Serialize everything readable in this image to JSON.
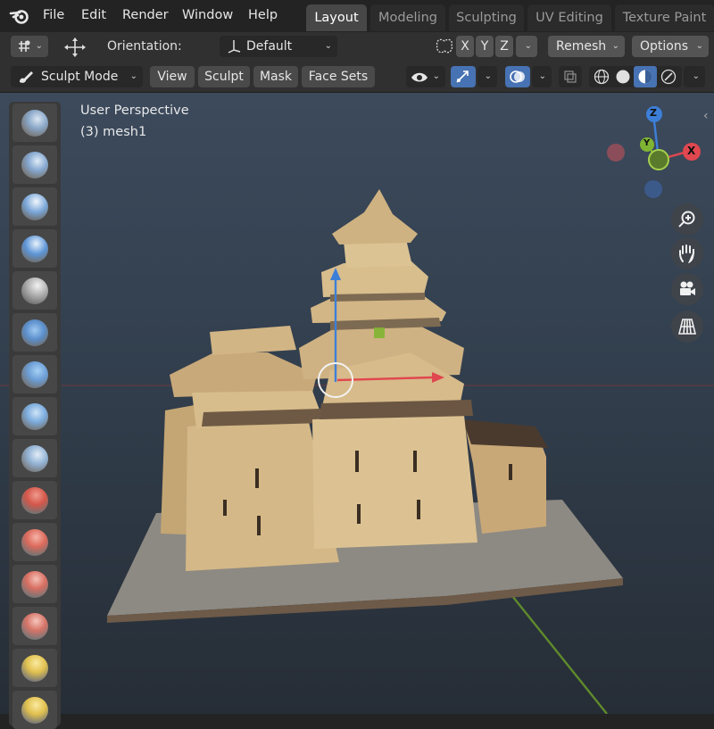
{
  "menu": [
    "File",
    "Edit",
    "Render",
    "Window",
    "Help"
  ],
  "workspaces": [
    "Layout",
    "Modeling",
    "Sculpting",
    "UV Editing",
    "Texture Paint"
  ],
  "active_workspace": "Layout",
  "tool_settings": {
    "orientation_label": "Orientation:",
    "orientation_value": "Default",
    "axes": [
      "X",
      "Y",
      "Z"
    ],
    "remesh_label": "Remesh",
    "options_label": "Options"
  },
  "header": {
    "mode_label": "Sculpt Mode",
    "menus": [
      "View",
      "Sculpt",
      "Mask",
      "Face Sets"
    ]
  },
  "viewport": {
    "perspective_label": "User Perspective",
    "object_label": "(3) mesh1"
  },
  "gizmo": {
    "x": "X",
    "y": "Y",
    "z": "Z"
  },
  "colors": {
    "accent": "#4772b3",
    "x_axis": "#e0474f",
    "y_axis": "#7fb432",
    "z_axis": "#3d7fd8",
    "model": "#d6b98a"
  },
  "icons": {
    "navigation": [
      "zoom-icon",
      "hand-pan-icon",
      "camera-icon",
      "grid-icon"
    ],
    "tools": [
      "draw-brush",
      "draw-sharp",
      "clay",
      "clay-strips",
      "layer",
      "inflate",
      "blob",
      "crease",
      "smooth",
      "flatten",
      "fill",
      "scrape",
      "multiplane-scrape",
      "pinch",
      "grab"
    ]
  }
}
